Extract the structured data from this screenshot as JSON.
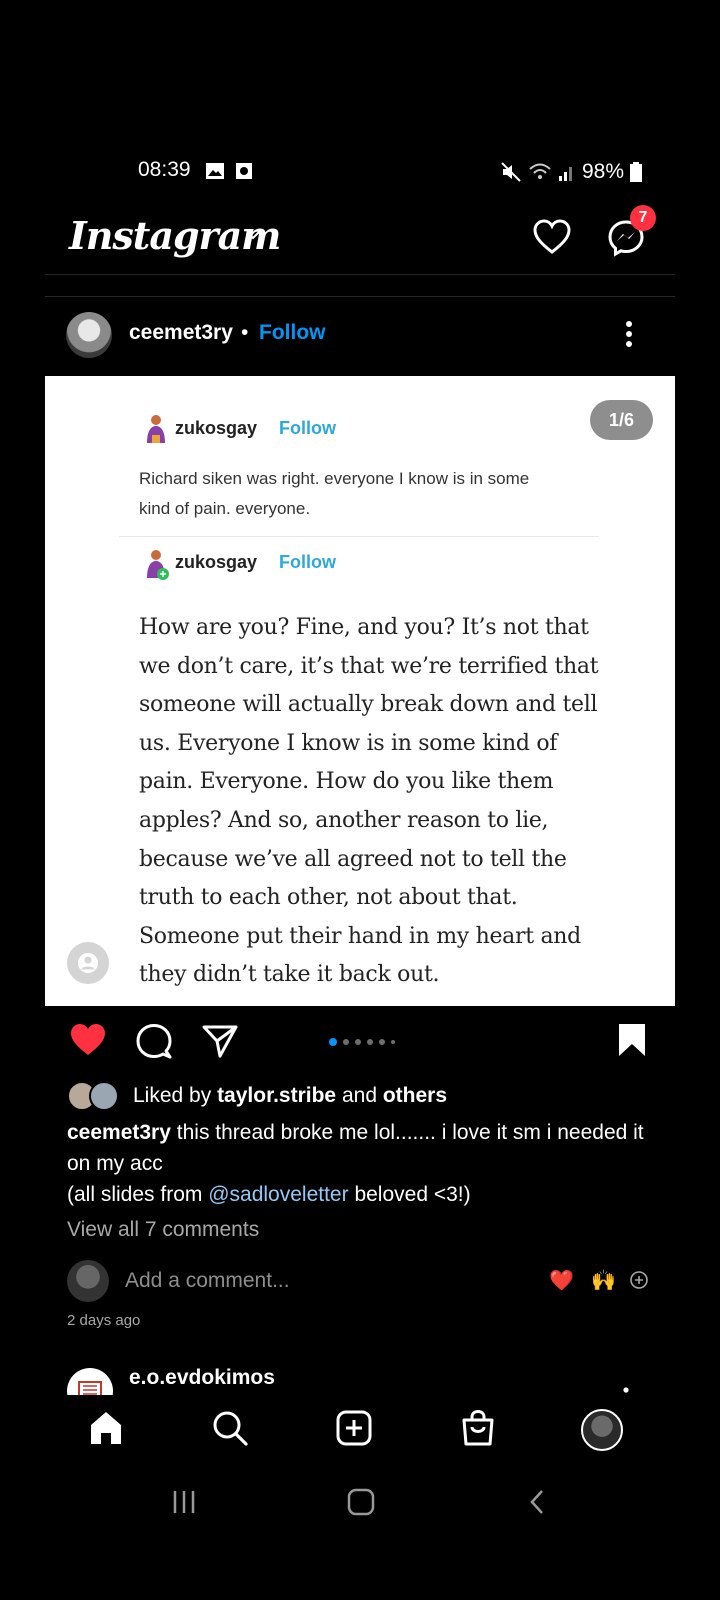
{
  "status_bar": {
    "time": "08:39",
    "battery": "98%"
  },
  "header": {
    "logo": "Instagram",
    "messages_badge": "7"
  },
  "post": {
    "username": "ceemet3ry",
    "separator": "•",
    "follow_label": "Follow",
    "slide_counter": "1/6",
    "slide": {
      "post1_user": "zukosgay",
      "post1_follow": "Follow",
      "post1_text": "Richard siken was right. everyone I know is in some kind of pain. everyone.",
      "post2_user": "zukosgay",
      "post2_follow": "Follow",
      "post2_quote": "How are you? Fine, and you? It’s not that we don’t care, it’s that we’re terrified that someone will actually break down and tell us. Everyone I know is in some kind of pain. Everyone. How do you like them apples? And so, another reason to lie, because we’ve all agreed not to tell the truth to each other, not about that. Someone put their hand in my heart and they didn’t take it back out."
    },
    "likes": {
      "prefix": "Liked by",
      "user": "taylor.stribe",
      "conjunction": "and",
      "others": "others"
    },
    "caption": {
      "username": "ceemet3ry",
      "text_line1": "this thread broke me lol....... i love it sm i needed it on my acc",
      "text_line2_prefix": "(all slides from",
      "mention": "@sadloveletter",
      "text_line2_suffix": "beloved <3!)"
    },
    "view_comments": "View all 7 comments",
    "add_comment_placeholder": "Add a comment...",
    "quick_emojis": [
      "❤️",
      "🙌"
    ],
    "timestamp": "2 days ago"
  },
  "next_post": {
    "username": "e.o.evdokimos"
  },
  "colors": {
    "accent_blue": "#0095f6",
    "like_red": "#ff3040",
    "tumblr_follow": "#2fa8d8"
  }
}
